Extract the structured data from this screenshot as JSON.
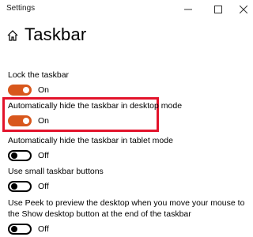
{
  "window": {
    "title": "Settings",
    "controls": {
      "minimize_icon": "minimize-icon",
      "maximize_icon": "maximize-icon",
      "close_icon": "close-icon"
    }
  },
  "header": {
    "home_icon": "home-icon",
    "title": "Taskbar"
  },
  "settings": [
    {
      "label": "Lock the taskbar",
      "state": "On",
      "on": true
    },
    {
      "label": "Automatically hide the taskbar in desktop mode",
      "state": "On",
      "on": true
    },
    {
      "label": "Automatically hide the taskbar in tablet mode",
      "state": "Off",
      "on": false
    },
    {
      "label": "Use small taskbar buttons",
      "state": "Off",
      "on": false
    },
    {
      "label": "Use Peek to preview the desktop when you move your mouse to the Show desktop button at the end of the taskbar",
      "state": "Off",
      "on": false
    }
  ],
  "colors": {
    "accent": "#d8571c",
    "highlight_border": "#e3132b"
  }
}
